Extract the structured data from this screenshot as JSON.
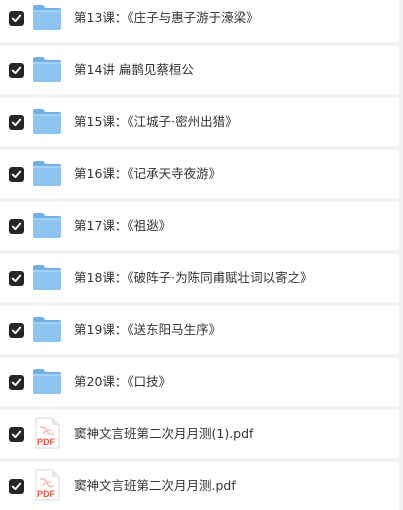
{
  "files": [
    {
      "name": "第13课：《庄子与惠子游于濠梁》",
      "type": "folder-icon",
      "checked": true
    },
    {
      "name": "第14讲 扁鹊见蔡桓公",
      "type": "folder-icon",
      "checked": true
    },
    {
      "name": "第15课：《江城子·密州出猎》",
      "type": "folder-icon",
      "checked": true
    },
    {
      "name": "第16课：《记承天寺夜游》",
      "type": "folder-icon",
      "checked": true
    },
    {
      "name": "第17课：《祖逖》",
      "type": "folder-icon",
      "checked": true
    },
    {
      "name": "第18课：《破阵子·为陈同甫赋壮词以寄之》",
      "type": "folder-icon",
      "checked": true
    },
    {
      "name": "第19课：《送东阳马生序》",
      "type": "folder-icon",
      "checked": true
    },
    {
      "name": "第20课：《口技》",
      "type": "folder-icon",
      "checked": true
    },
    {
      "name": "窦神文言班第二次月月测(1).pdf",
      "type": "pdf-icon",
      "checked": true,
      "badge": "PDF"
    },
    {
      "name": "窦神文言班第二次月月测.pdf",
      "type": "pdf-icon",
      "checked": true,
      "badge": "PDF"
    }
  ],
  "colors": {
    "folder": "#8cc4f2",
    "folder_tab": "#6fb0ea",
    "pdf": "#e8563f",
    "checkbox": "#262626",
    "row_bg": "#ffffff",
    "page_bg": "#f2f2f2"
  }
}
